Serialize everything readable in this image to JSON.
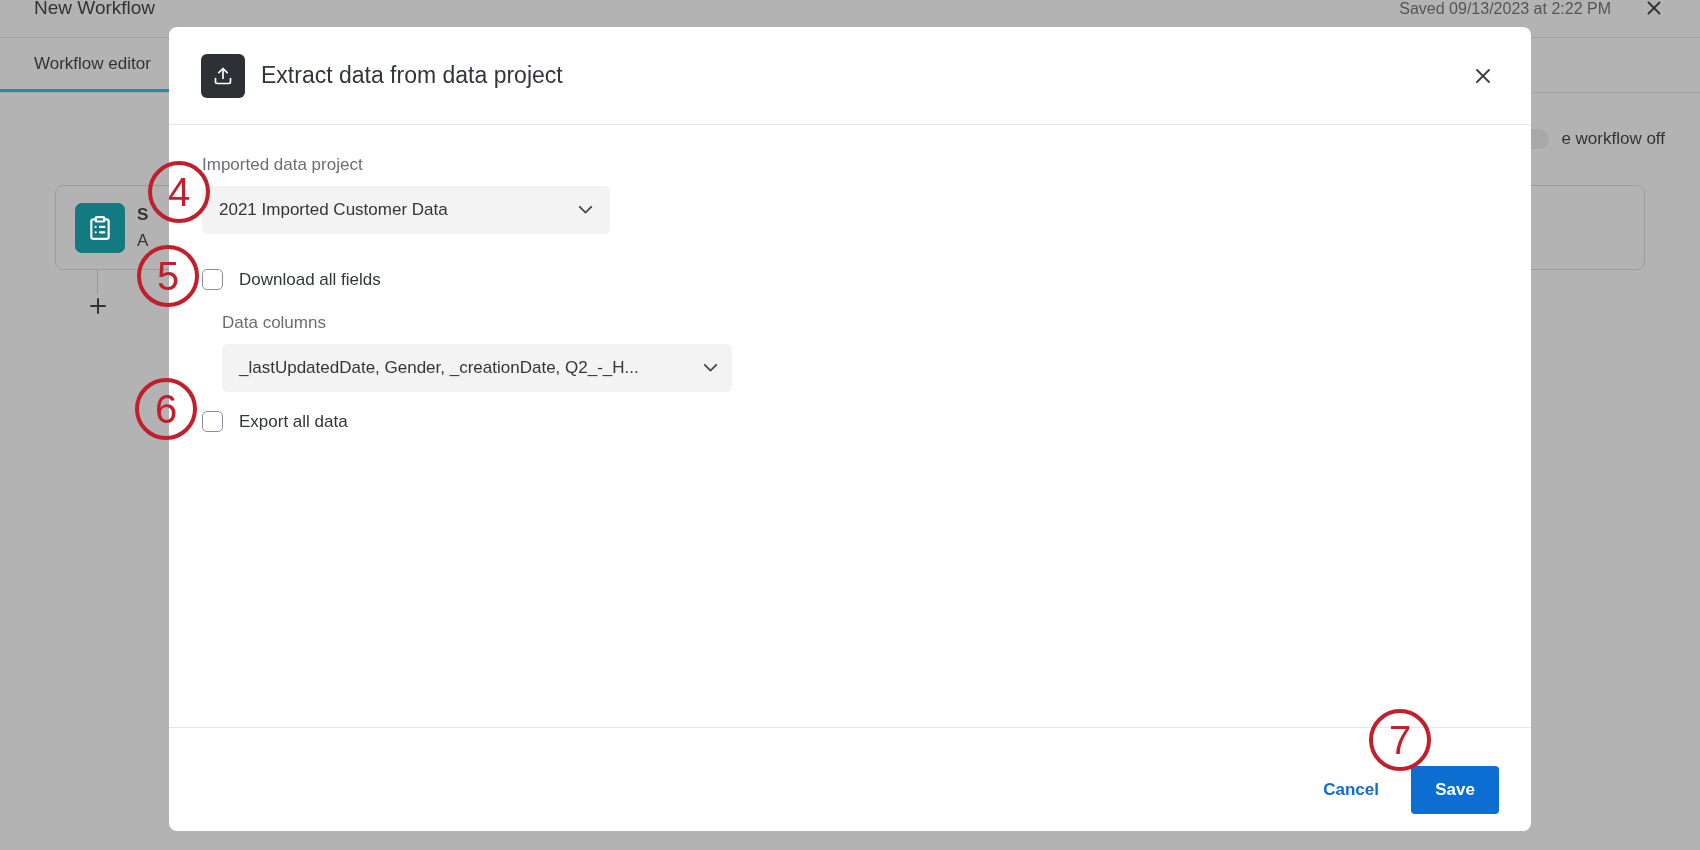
{
  "page": {
    "title": "New Workflow",
    "saved": "Saved 09/13/2023 at 2:22 PM",
    "tabs": [
      {
        "label": "Workflow editor",
        "selected": true
      }
    ],
    "toggle_label": "e workflow off",
    "toggle_on": false,
    "card": {
      "title": "S",
      "description": "A"
    }
  },
  "modal": {
    "title": "Extract data from data project",
    "project": {
      "label": "Imported data project",
      "value": "2021 Imported Customer Data"
    },
    "download_all": {
      "label": "Download all fields",
      "checked": false
    },
    "columns": {
      "label": "Data columns",
      "value": "_lastUpdatedDate, Gender, _creationDate, Q2_-_H..."
    },
    "export_all": {
      "label": "Export all data",
      "checked": false
    },
    "buttons": [
      {
        "kind": "link",
        "label": "Cancel"
      },
      {
        "kind": "primary",
        "label": "Save"
      }
    ]
  },
  "callouts": [
    {
      "number": "4"
    },
    {
      "number": "5"
    },
    {
      "number": "6"
    },
    {
      "number": "7"
    }
  ]
}
